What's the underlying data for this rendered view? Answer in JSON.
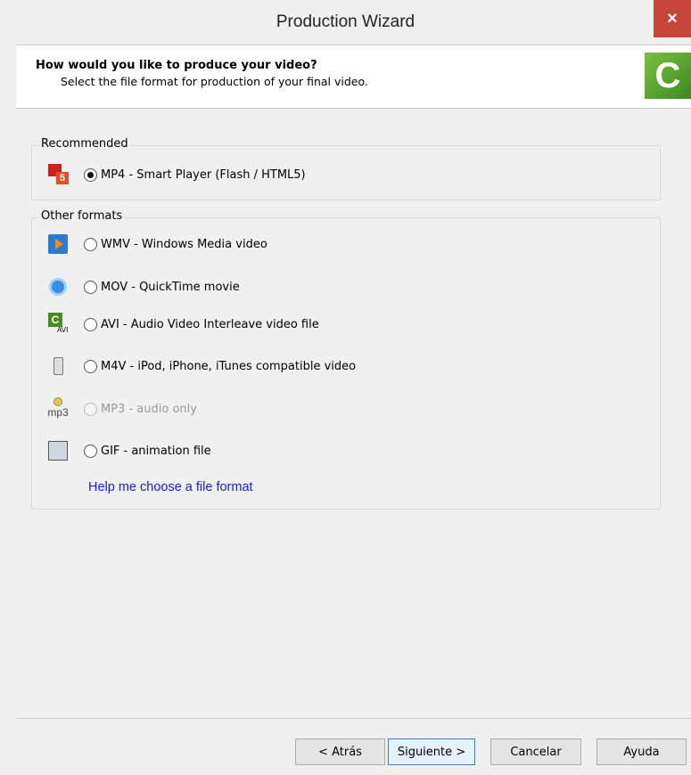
{
  "window": {
    "title": "Production Wizard",
    "close_label": "×"
  },
  "header": {
    "heading": "How would you like to produce your video?",
    "subheading": "Select the file format for production of your final video.",
    "logo_text": "C"
  },
  "recommended": {
    "legend": "Recommended",
    "options": [
      {
        "label": "MP4 - Smart Player (Flash / HTML5)",
        "icon": "mp4-html5-icon",
        "checked": true,
        "disabled": false
      }
    ]
  },
  "other_formats": {
    "legend": "Other formats",
    "options": [
      {
        "label": "WMV - Windows Media video",
        "icon": "wmv-icon",
        "checked": false,
        "disabled": false
      },
      {
        "label": "MOV - QuickTime movie",
        "icon": "quicktime-icon",
        "checked": false,
        "disabled": false
      },
      {
        "label": "AVI - Audio Video Interleave video file",
        "icon": "avi-icon",
        "icon_text": "AVI",
        "checked": false,
        "disabled": false
      },
      {
        "label": "M4V - iPod, iPhone, iTunes compatible video",
        "icon": "ipod-icon",
        "checked": false,
        "disabled": false
      },
      {
        "label": "MP3 - audio only",
        "icon": "mp3-icon",
        "icon_text": "mp3",
        "checked": false,
        "disabled": true
      },
      {
        "label": "GIF - animation file",
        "icon": "gif-icon",
        "checked": false,
        "disabled": false
      }
    ],
    "help_link": "Help me choose a file format"
  },
  "footer": {
    "back": "< Atrás",
    "next": "Siguiente >",
    "cancel": "Cancelar",
    "help": "Ayuda"
  },
  "colors": {
    "background": "#f0f0f0",
    "close_button": "#c7453a",
    "link": "#1a1ad6",
    "logo": "#4a9a2a"
  }
}
